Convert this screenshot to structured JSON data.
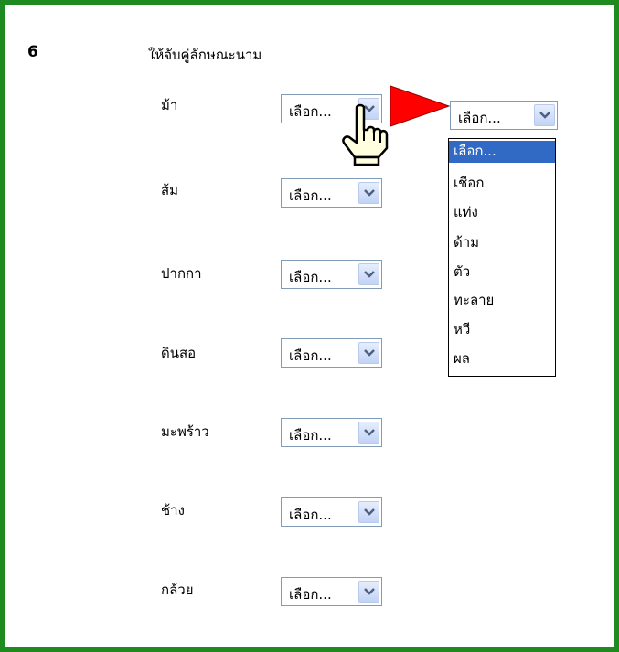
{
  "question": {
    "number": "6",
    "text": "ให้จับคู่ลักษณะนาม"
  },
  "rows": [
    {
      "label": "ม้า",
      "select_value": "เลือก..."
    },
    {
      "label": "ส้ม",
      "select_value": "เลือก..."
    },
    {
      "label": "ปากกา",
      "select_value": "เลือก..."
    },
    {
      "label": "ดินสอ",
      "select_value": "เลือก..."
    },
    {
      "label": "มะพร้าว",
      "select_value": "เลือก..."
    },
    {
      "label": "ช้าง",
      "select_value": "เลือก..."
    },
    {
      "label": "กล้วย",
      "select_value": "เลือก..."
    }
  ],
  "open_select": {
    "value": "เลือก...",
    "options": [
      "เลือก...",
      "เชือก",
      "แท่ง",
      "ด้าม",
      "ตัว",
      "ทะลาย",
      "หวี",
      "ผล"
    ],
    "highlighted": "เลือก..."
  },
  "colors": {
    "frame_border": "#1f8a1f",
    "highlight": "#316ac5",
    "pointer_arrow": "#ff0000"
  },
  "icons": {
    "pointer": "red-triangle-arrow-icon",
    "cursor": "hand-cursor-icon",
    "dropdown_arrow": "chevron-down-icon"
  }
}
